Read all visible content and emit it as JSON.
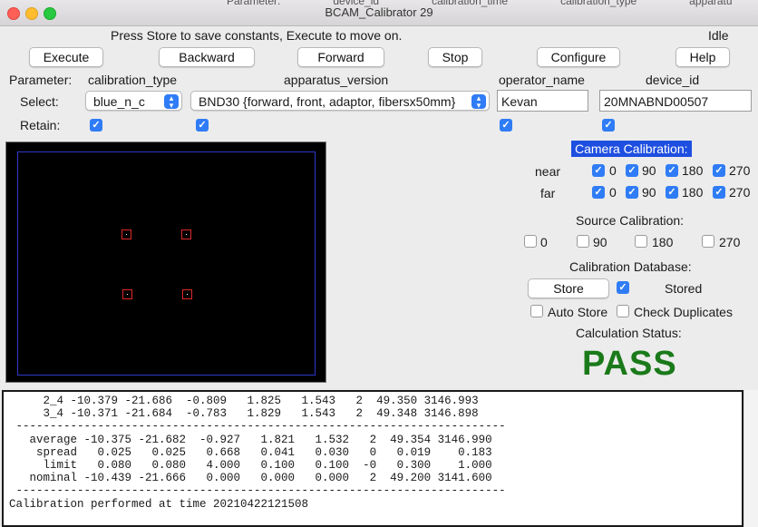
{
  "window": {
    "title": "BCAM_Calibrator 29",
    "background_tabs": [
      "Parameter:",
      "device_id",
      "calibration_time",
      "calibration_type",
      "apparatu"
    ]
  },
  "status_bar": {
    "message": "Press Store to save constants, Execute to move on.",
    "state": "Idle"
  },
  "toolbar": {
    "execute": "Execute",
    "backward": "Backward",
    "forward": "Forward",
    "stop": "Stop",
    "configure": "Configure",
    "help": "Help"
  },
  "params": {
    "row_labels": {
      "parameter": "Parameter:",
      "select": "Select:",
      "retain": "Retain:"
    },
    "headers": {
      "calibration_type": "calibration_type",
      "apparatus_version": "apparatus_version",
      "operator_name": "operator_name",
      "device_id": "device_id"
    },
    "values": {
      "calibration_type": "blue_n_c",
      "apparatus_version": "BND30 {forward, front, adaptor, fibersx50mm}",
      "operator_name": "Kevan",
      "device_id": "20MNABND00507"
    }
  },
  "camera_calibration": {
    "title": "Camera Calibration:",
    "near_label": "near",
    "far_label": "far",
    "angles": [
      "0",
      "90",
      "180",
      "270"
    ]
  },
  "source_calibration": {
    "title": "Source Calibration:",
    "angles": [
      "0",
      "90",
      "180",
      "270"
    ]
  },
  "database": {
    "title": "Calibration Database:",
    "store": "Store",
    "stored": "Stored",
    "auto_store": "Auto Store",
    "check_duplicates": "Check Duplicates"
  },
  "calc_status": {
    "title": "Calculation Status:",
    "value": "PASS"
  },
  "output_text": "     2_4 -10.379 -21.686  -0.809   1.825   1.543   2  49.350 3146.993\n     3_4 -10.371 -21.684  -0.783   1.829   1.543   2  49.348 3146.898\n ------------------------------------------------------------------------\n   average -10.375 -21.682  -0.927   1.821   1.532   2  49.354 3146.990\n    spread   0.025   0.025   0.668   0.041   0.030   0   0.019    0.183\n     limit   0.080   0.080   4.000   0.100   0.100  -0   0.300    1.000\n   nominal -10.439 -21.666   0.000   0.000   0.000   2  49.200 3141.600\n ------------------------------------------------------------------------\nCalibration performed at time 20210422121508",
  "colors": {
    "accent": "#2f7cf6",
    "pass": "#1a7a1a",
    "spot": "#e02828",
    "frame": "#2c39c9"
  }
}
